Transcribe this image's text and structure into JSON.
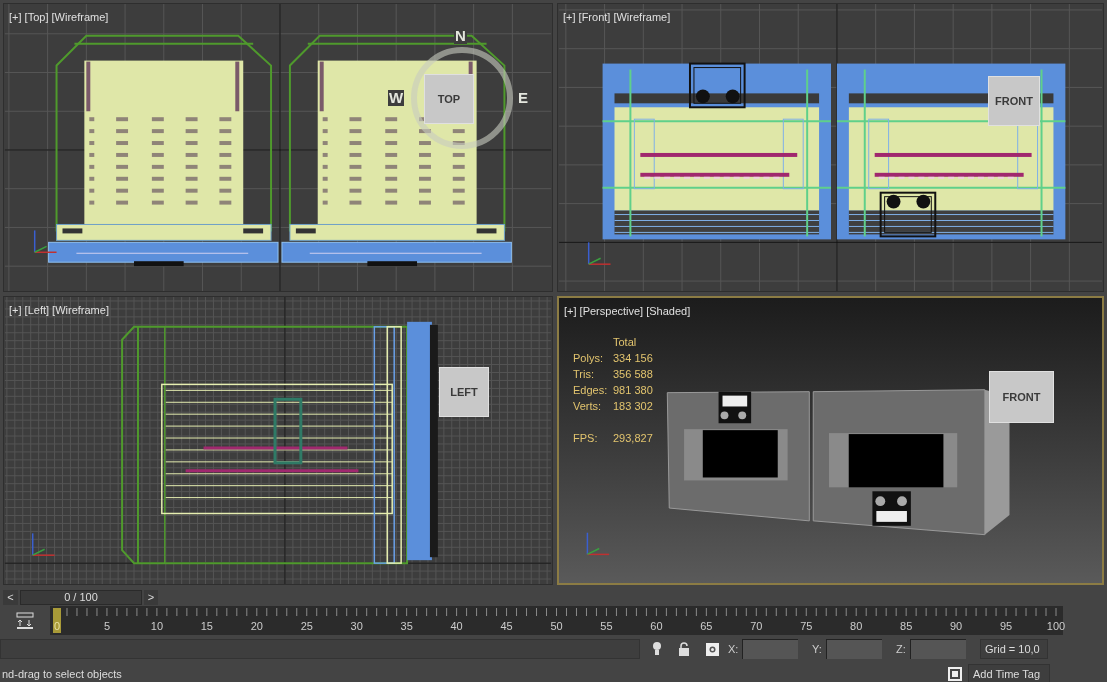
{
  "viewports": [
    {
      "label": "[+] [Top] [Wireframe]",
      "kind": "top",
      "active": false,
      "view_cube": "TOP",
      "compass": [
        "N",
        "W",
        "E"
      ]
    },
    {
      "label": "[+] [Front] [Wireframe]",
      "kind": "front",
      "active": false,
      "view_cube": "FRONT"
    },
    {
      "label": "[+] [Left] [Wireframe]",
      "kind": "left",
      "active": false,
      "view_cube": "LEFT"
    },
    {
      "label": "[+] [Perspective] [Shaded]",
      "kind": "perspective",
      "active": true,
      "view_cube": "FRONT",
      "stats": {
        "heading": "Total",
        "rows": [
          {
            "label": "Polys:",
            "value": "334 156"
          },
          {
            "label": "Tris:",
            "value": "356 588"
          },
          {
            "label": "Edges:",
            "value": "981 380"
          },
          {
            "label": "Verts:",
            "value": "183 302"
          }
        ],
        "fps": {
          "label": "FPS:",
          "value": "293,827"
        }
      }
    }
  ],
  "timeline": {
    "prev": "<",
    "position": "0 / 100",
    "next": ">",
    "current_frame": "0",
    "ticks": [
      "5",
      "10",
      "15",
      "20",
      "25",
      "30",
      "35",
      "40",
      "45",
      "50",
      "55",
      "60",
      "65",
      "70",
      "75",
      "80",
      "85",
      "90",
      "95",
      "100"
    ]
  },
  "status": {
    "prompt": "nd-drag to select objects",
    "coords": [
      {
        "label": "X:"
      },
      {
        "label": "Y:"
      },
      {
        "label": "Z:"
      }
    ],
    "grid": "Grid = 10,0",
    "time_tag": "Add Time Tag"
  }
}
